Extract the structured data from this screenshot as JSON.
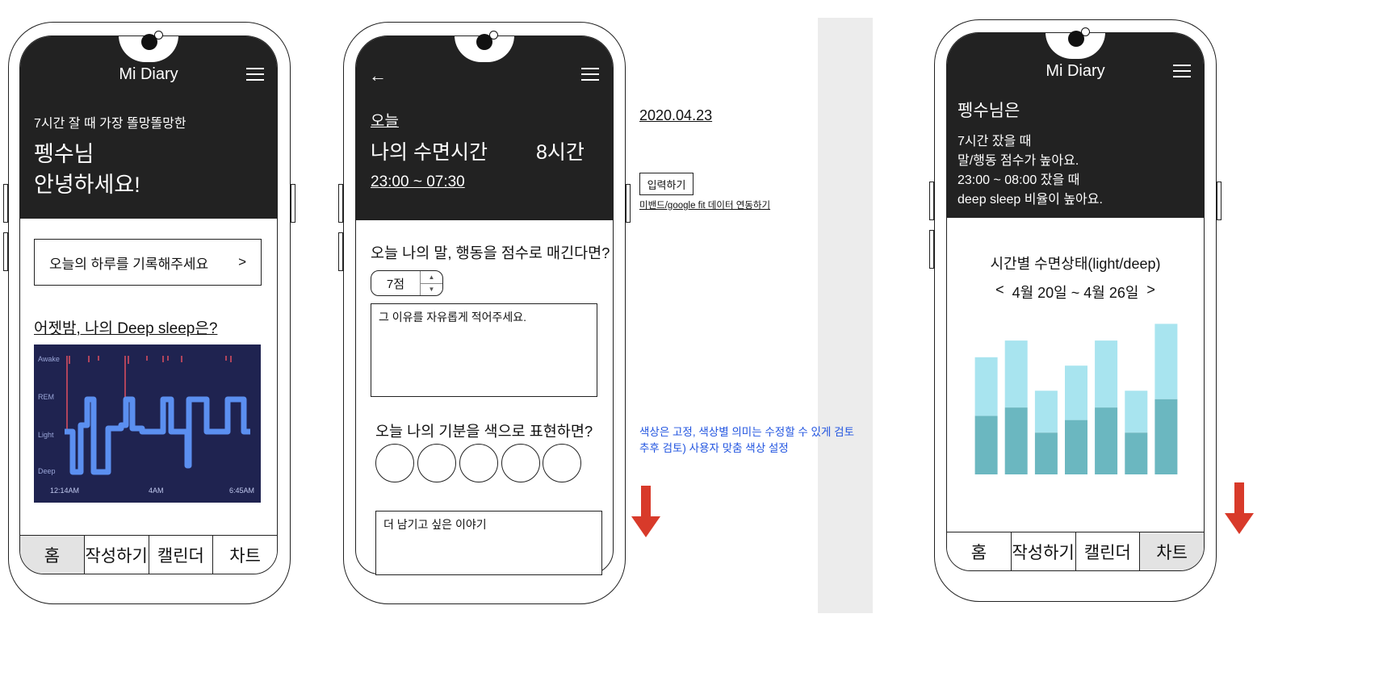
{
  "phone1": {
    "title": "Mi Diary",
    "subtitle": "7시간 잘 때 가장 똘망똘망한",
    "name": "펭수님",
    "greeting": "안녕하세요!",
    "record_prompt": "오늘의 하루를 기록해주세요",
    "record_arrow": ">",
    "deep_sleep_title": "어젯밤, 나의 Deep sleep은?",
    "sleep_chart": {
      "y_labels": [
        "Awake",
        "REM",
        "Light",
        "Deep"
      ],
      "x_labels": [
        "12:14AM",
        "4AM",
        "6:45AM"
      ],
      "bg": "#1f2350",
      "line_color": "#5b8ff0",
      "awake_color": "#e05060"
    },
    "tabs": [
      "홈",
      "작성하기",
      "캘린더",
      "차트"
    ],
    "active_tab": "홈"
  },
  "phone2": {
    "back_icon": "←",
    "today_label": "오늘",
    "sleep_label": "나의 수면시간",
    "sleep_hours": "8시간",
    "sleep_range": "23:00 ~ 07:30",
    "score_question": "오늘 나의 말, 행동을 점수로 매긴다면?",
    "score_value": "7점",
    "reason_placeholder": "그 이유를 자유롭게 적어주세요.",
    "mood_question": "오늘 나의 기분을 색으로 표현하면?",
    "mood_colors_count": 5,
    "extra_placeholder": "더 남기고 싶은 이야기"
  },
  "annotations": {
    "date": "2020.04.23",
    "input_button": "입력하기",
    "sync_link": "미밴드/google fit 데이터 연동하기",
    "note_line1": "색상은 고정, 색상별 의미는 수정할 수 있게 검토",
    "note_line2": "추후 검토) 사용자 맞춤 색상 설정",
    "note_color": "#2255e0",
    "arrow_color": "#d83a2a"
  },
  "phone3": {
    "title": "Mi Diary",
    "name_line": "펭수님은",
    "insight1": "7시간 잤을 때",
    "insight2": "말/행동 점수가 높아요.",
    "insight3": "23:00 ~ 08:00 잤을 때",
    "insight4": "deep sleep 비율이 높아요.",
    "chart_title": "시간별 수면상태(light/deep)",
    "prev": "<",
    "range": "4월 20일 ~ 4월 26일",
    "next": ">",
    "tabs": [
      "홈",
      "작성하기",
      "캘린더",
      "차트"
    ],
    "active_tab": "차트"
  },
  "chart_data": {
    "type": "bar",
    "title": "시간별 수면상태(light/deep)",
    "stacked": true,
    "categories": [
      "",
      "",
      "",
      "",
      "",
      "",
      ""
    ],
    "series": [
      {
        "name": "deep",
        "color": "#6bb7c0",
        "values": [
          7,
          8,
          5,
          6.5,
          8,
          5,
          9
        ]
      },
      {
        "name": "light",
        "color": "#a8e4ef",
        "values": [
          7,
          8,
          5,
          6.5,
          8,
          5,
          9
        ]
      }
    ],
    "ylim": [
      0,
      19
    ]
  }
}
